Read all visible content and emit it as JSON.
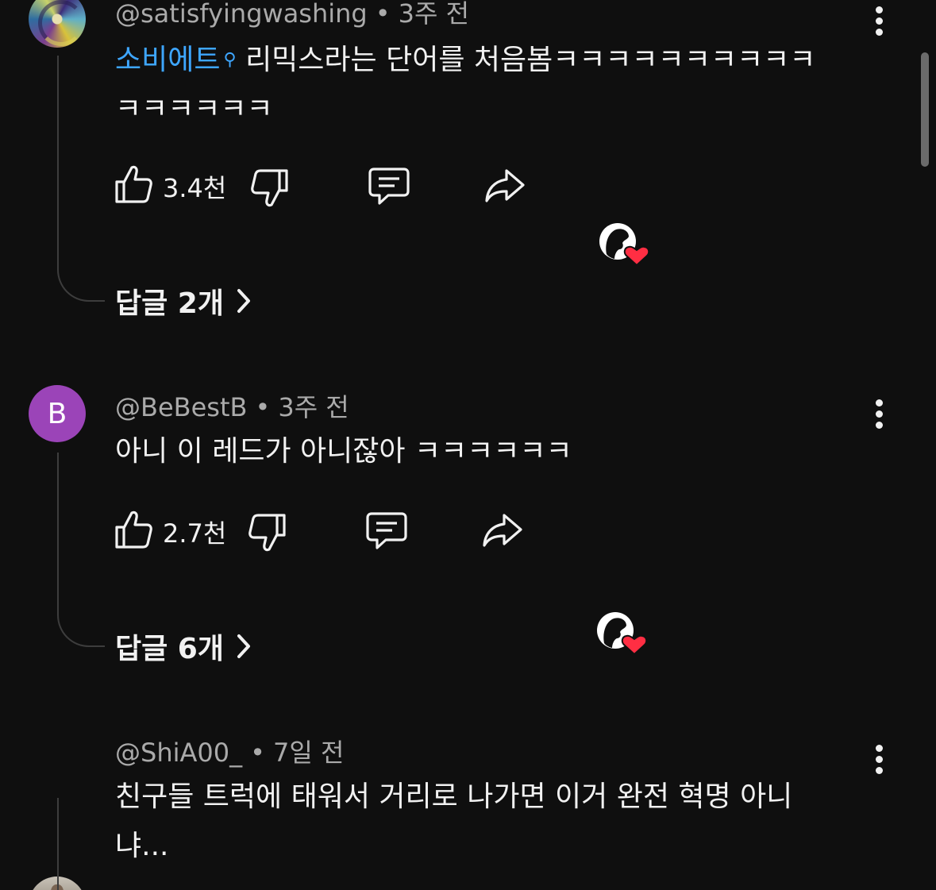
{
  "comments": [
    {
      "author": "@satisfyingwashing",
      "time": "3주 전",
      "separator": "•",
      "mention": "소비에트",
      "text_line1": "리믹스라는 단어를 처음봄ㅋㅋㅋㅋㅋㅋㅋㅋㅋㅋ",
      "text_line2": "ㅋㅋㅋㅋㅋㅋ",
      "likes": "3.4천",
      "replies": "답글 2개"
    },
    {
      "author": "@BeBestB",
      "avatar_letter": "B",
      "time": "3주 전",
      "separator": "•",
      "text_line1": "아니 이 레드가 아니잖아 ㅋㅋㅋㅋㅋㅋ",
      "likes": "2.7천",
      "replies": "답글 6개"
    },
    {
      "author": "@ShiA00_",
      "time": "7일 전",
      "separator": "•",
      "text_line1": "친구들 트럭에 태워서 거리로 나가면 이거 완전 혁명 아니",
      "text_line2": "냐..."
    }
  ],
  "icons": {
    "like": "thumbs-up-icon",
    "dislike": "thumbs-down-icon",
    "reply": "comment-icon",
    "share": "share-icon",
    "creator_heart": "creator-heart-icon",
    "more": "more-vert-icon",
    "chevron": "chevron-right-icon"
  },
  "colors": {
    "background": "#0f0f0f",
    "text": "#f1f1f1",
    "meta": "#aaaaaa",
    "mention": "#3ea6ff",
    "heart": "#ff2e43",
    "avatar_b": "#9b44b8"
  }
}
